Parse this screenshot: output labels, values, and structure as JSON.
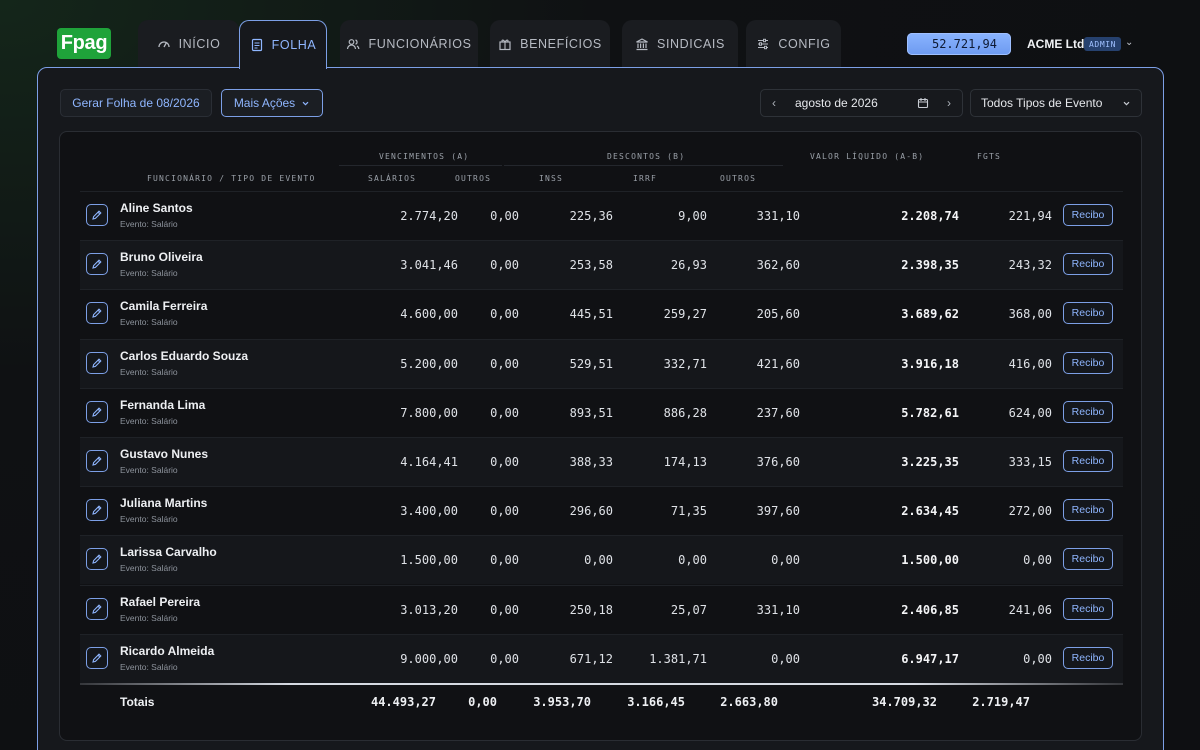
{
  "brand": {
    "logo_text": "Fpag",
    "logo_color": "#1fa33a"
  },
  "nav": {
    "tabs": [
      {
        "label": "INÍCIO",
        "icon": "gauge-icon"
      },
      {
        "label": "FOLHA",
        "icon": "document-icon",
        "active": true
      },
      {
        "label": "FUNCIONÁRIOS",
        "icon": "users-icon"
      },
      {
        "label": "BENEFÍCIOS",
        "icon": "gift-icon"
      },
      {
        "label": "SINDICAIS",
        "icon": "bank-icon"
      },
      {
        "label": "CONFIG",
        "icon": "sliders-icon"
      }
    ]
  },
  "account": {
    "balance": "52.721,94",
    "company": "ACME Ltda",
    "role_badge": "ADMIN"
  },
  "toolbar": {
    "generate_label": "Gerar Folha de 08/2026",
    "more_actions_label": "Mais Ações",
    "month_label": "agosto de 2026",
    "event_filter_label": "Todos Tipos de Evento"
  },
  "table": {
    "group_headers": {
      "vencimentos": "VENCIMENTOS (A)",
      "descontos": "DESCONTOS (B)",
      "liquido": "VALOR LÍQUIDO (A-B)",
      "fgts": "FGTS"
    },
    "columns": {
      "employee": "FUNCIONÁRIO / TIPO DE EVENTO",
      "salarios": "SALÁRIOS",
      "outros_venc": "OUTROS",
      "inss": "INSS",
      "irrf": "IRRF",
      "outros_desc": "OUTROS"
    },
    "receipt_label": "Recibo",
    "rows": [
      {
        "name": "Aline Santos",
        "event": "Evento: Salário",
        "salarios": "2.774,20",
        "outros_venc": "0,00",
        "inss": "225,36",
        "irrf": "9,00",
        "outros_desc": "331,10",
        "liquido": "2.208,74",
        "fgts": "221,94"
      },
      {
        "name": "Bruno Oliveira",
        "event": "Evento: Salário",
        "salarios": "3.041,46",
        "outros_venc": "0,00",
        "inss": "253,58",
        "irrf": "26,93",
        "outros_desc": "362,60",
        "liquido": "2.398,35",
        "fgts": "243,32"
      },
      {
        "name": "Camila Ferreira",
        "event": "Evento: Salário",
        "salarios": "4.600,00",
        "outros_venc": "0,00",
        "inss": "445,51",
        "irrf": "259,27",
        "outros_desc": "205,60",
        "liquido": "3.689,62",
        "fgts": "368,00"
      },
      {
        "name": "Carlos Eduardo Souza",
        "event": "Evento: Salário",
        "salarios": "5.200,00",
        "outros_venc": "0,00",
        "inss": "529,51",
        "irrf": "332,71",
        "outros_desc": "421,60",
        "liquido": "3.916,18",
        "fgts": "416,00"
      },
      {
        "name": "Fernanda Lima",
        "event": "Evento: Salário",
        "salarios": "7.800,00",
        "outros_venc": "0,00",
        "inss": "893,51",
        "irrf": "886,28",
        "outros_desc": "237,60",
        "liquido": "5.782,61",
        "fgts": "624,00"
      },
      {
        "name": "Gustavo Nunes",
        "event": "Evento: Salário",
        "salarios": "4.164,41",
        "outros_venc": "0,00",
        "inss": "388,33",
        "irrf": "174,13",
        "outros_desc": "376,60",
        "liquido": "3.225,35",
        "fgts": "333,15"
      },
      {
        "name": "Juliana Martins",
        "event": "Evento: Salário",
        "salarios": "3.400,00",
        "outros_venc": "0,00",
        "inss": "296,60",
        "irrf": "71,35",
        "outros_desc": "397,60",
        "liquido": "2.634,45",
        "fgts": "272,00"
      },
      {
        "name": "Larissa Carvalho",
        "event": "Evento: Salário",
        "salarios": "1.500,00",
        "outros_venc": "0,00",
        "inss": "0,00",
        "irrf": "0,00",
        "outros_desc": "0,00",
        "liquido": "1.500,00",
        "fgts": "0,00"
      },
      {
        "name": "Rafael Pereira",
        "event": "Evento: Salário",
        "salarios": "3.013,20",
        "outros_venc": "0,00",
        "inss": "250,18",
        "irrf": "25,07",
        "outros_desc": "331,10",
        "liquido": "2.406,85",
        "fgts": "241,06"
      },
      {
        "name": "Ricardo Almeida",
        "event": "Evento: Salário",
        "salarios": "9.000,00",
        "outros_venc": "0,00",
        "inss": "671,12",
        "irrf": "1.381,71",
        "outros_desc": "0,00",
        "liquido": "6.947,17",
        "fgts": "0,00"
      }
    ],
    "totals": {
      "label": "Totais",
      "salarios": "44.493,27",
      "outros_venc": "0,00",
      "inss": "3.953,70",
      "irrf": "3.166,45",
      "outros_desc": "2.663,80",
      "liquido": "34.709,32",
      "fgts": "2.719,47"
    }
  },
  "colors": {
    "accent": "#7c9fe6",
    "accent_text": "#8fb6ff",
    "background": "#0f1113"
  }
}
